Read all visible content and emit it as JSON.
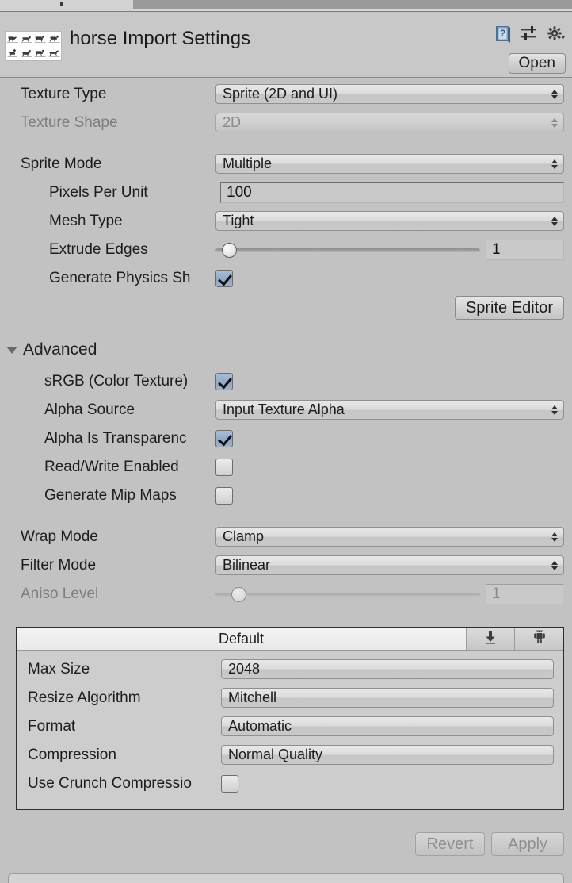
{
  "window": {
    "title": "horse Import Settings",
    "thumbnail_icon": "horse-spritesheet-thumbnail",
    "help_icon": "help-book-icon",
    "preset_icon": "preset-sliders-icon",
    "gear_icon": "gear-dropdown-icon",
    "open_label": "Open"
  },
  "texture": {
    "texture_type_label": "Texture Type",
    "texture_type_value": "Sprite (2D and UI)",
    "texture_shape_label": "Texture Shape",
    "texture_shape_value": "2D"
  },
  "sprite": {
    "sprite_mode_label": "Sprite Mode",
    "sprite_mode_value": "Multiple",
    "pixels_per_unit_label": "Pixels Per Unit",
    "pixels_per_unit_value": "100",
    "mesh_type_label": "Mesh Type",
    "mesh_type_value": "Tight",
    "extrude_edges_label": "Extrude Edges",
    "extrude_edges_value": "1",
    "generate_physics_shape_label": "Generate Physics Sh",
    "generate_physics_shape_checked": true,
    "sprite_editor_label": "Sprite Editor"
  },
  "advanced": {
    "header_label": "Advanced",
    "expanded": true,
    "srgb_label": "sRGB (Color Texture)",
    "srgb_checked": true,
    "alpha_source_label": "Alpha Source",
    "alpha_source_value": "Input Texture Alpha",
    "alpha_is_transparency_label": "Alpha Is Transparenc",
    "alpha_is_transparency_checked": true,
    "read_write_label": "Read/Write Enabled",
    "read_write_checked": false,
    "mip_maps_label": "Generate Mip Maps",
    "mip_maps_checked": false
  },
  "filtering": {
    "wrap_mode_label": "Wrap Mode",
    "wrap_mode_value": "Clamp",
    "filter_mode_label": "Filter Mode",
    "filter_mode_value": "Bilinear",
    "aniso_level_label": "Aniso Level",
    "aniso_level_value": "1"
  },
  "platform": {
    "tabs": [
      {
        "label": "Default",
        "icon": "",
        "active": true
      },
      {
        "label": "",
        "icon": "standalone-download-icon",
        "active": false
      },
      {
        "label": "",
        "icon": "android-robot-icon",
        "active": false
      }
    ],
    "max_size_label": "Max Size",
    "max_size_value": "2048",
    "resize_algorithm_label": "Resize Algorithm",
    "resize_algorithm_value": "Mitchell",
    "format_label": "Format",
    "format_value": "Automatic",
    "compression_label": "Compression",
    "compression_value": "Normal Quality",
    "crunch_label": "Use Crunch Compressio",
    "crunch_checked": false
  },
  "footer": {
    "revert_label": "Revert",
    "apply_label": "Apply"
  }
}
